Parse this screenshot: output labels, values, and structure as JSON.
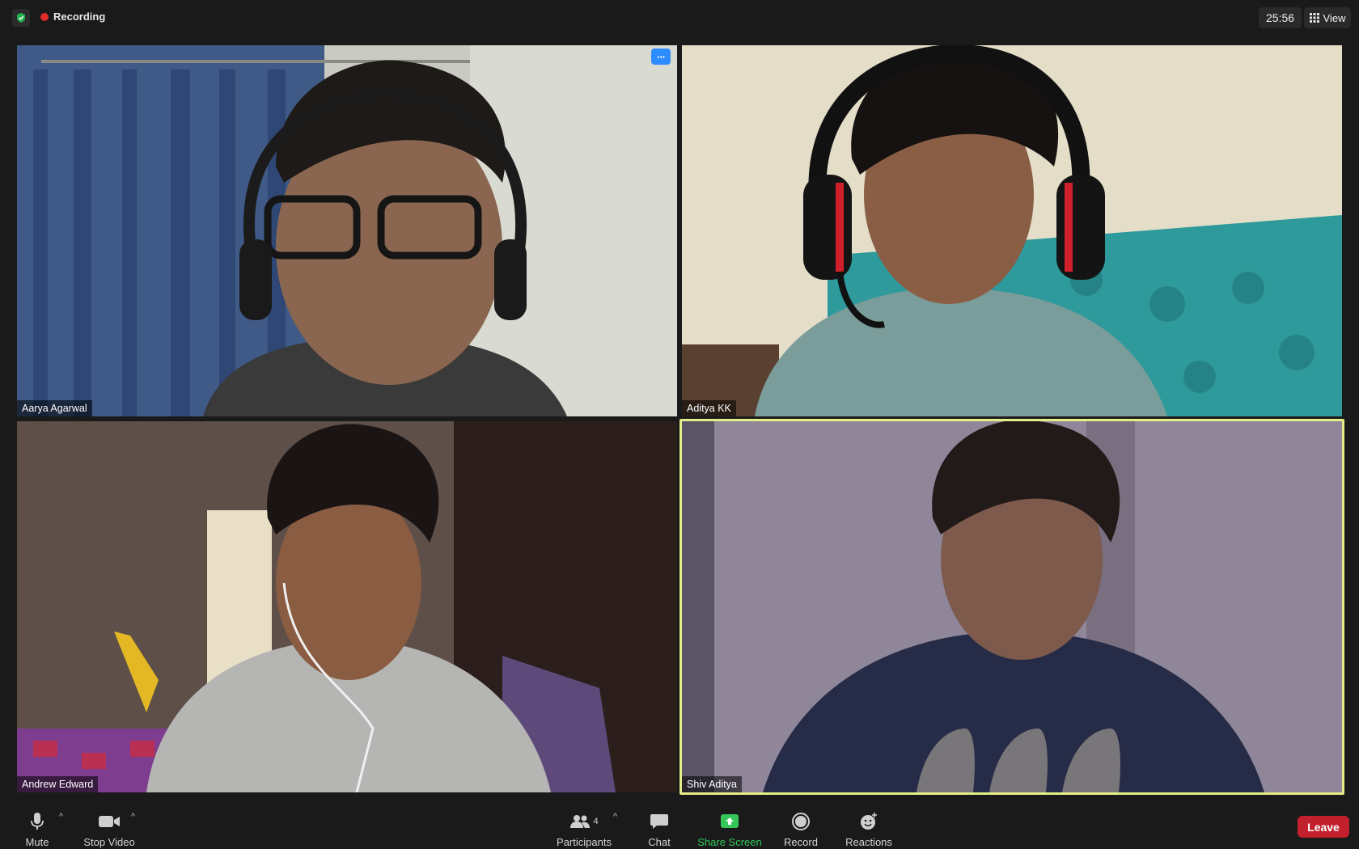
{
  "topbar": {
    "recording_label": "Recording",
    "timer": "25:56",
    "view_label": "View"
  },
  "participants": [
    {
      "name": "Aarya Agarwal"
    },
    {
      "name": "Aditya KK"
    },
    {
      "name": "Andrew Edward"
    },
    {
      "name": "Shiv Aditya"
    }
  ],
  "tile_menu": {
    "label": "···"
  },
  "toolbar": {
    "mute_label": "Mute",
    "stop_video_label": "Stop Video",
    "participants_label": "Participants",
    "participants_count": "4",
    "chat_label": "Chat",
    "share_screen_label": "Share Screen",
    "record_label": "Record",
    "reactions_label": "Reactions",
    "leave_label": "Leave"
  },
  "colors": {
    "active_speaker_border": "#e3ee86",
    "share_green": "#34c659",
    "leave_red": "#c2202c",
    "recording_red": "#e02b2b",
    "menu_blue": "#2d8cff"
  }
}
